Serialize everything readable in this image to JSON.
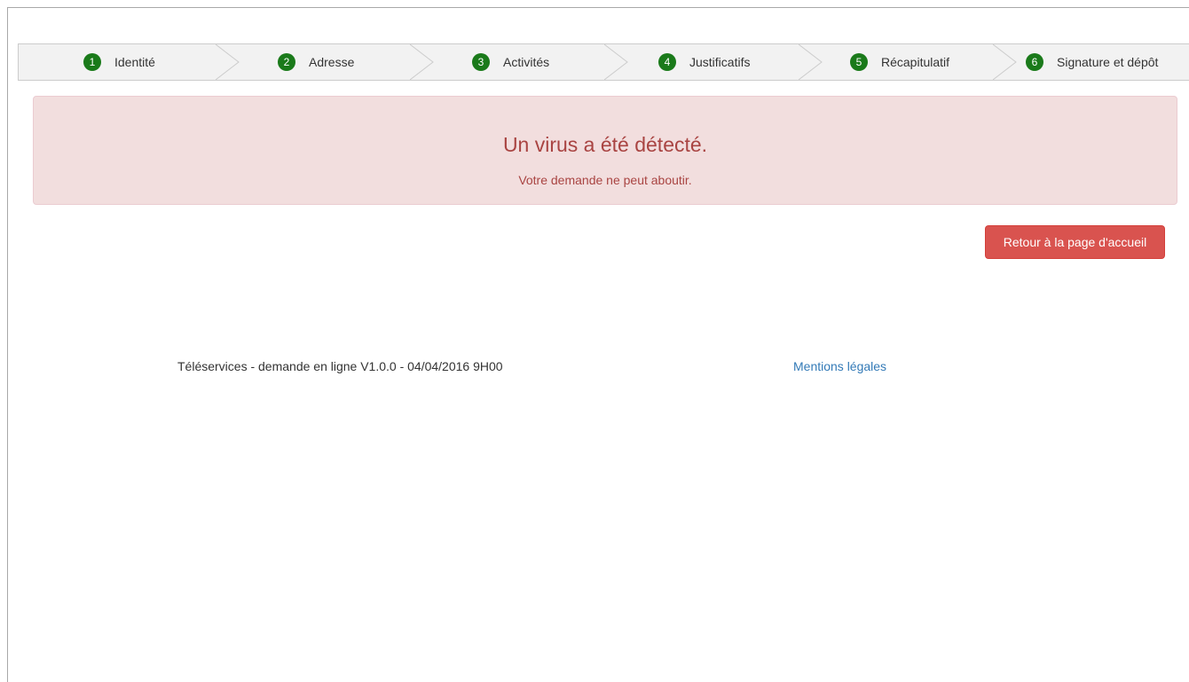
{
  "steps": [
    {
      "number": "1",
      "label": "Identité"
    },
    {
      "number": "2",
      "label": "Adresse"
    },
    {
      "number": "3",
      "label": "Activités"
    },
    {
      "number": "4",
      "label": "Justificatifs"
    },
    {
      "number": "5",
      "label": "Récapitulatif"
    },
    {
      "number": "6",
      "label": "Signature et dépôt"
    }
  ],
  "alert": {
    "title": "Un virus a été détecté.",
    "message": "Votre demande ne peut aboutir."
  },
  "actions": {
    "home_label": "Retour à la page d'accueil"
  },
  "footer": {
    "version_text": "Téléservices - demande en ligne V1.0.0 - 04/04/2016 9H00",
    "legal_link": "Mentions légales"
  },
  "colors": {
    "step_badge": "#1a7a1a",
    "alert_background": "#f2dede",
    "alert_text": "#a94442",
    "danger_button": "#d9534f",
    "link": "#337ab7"
  }
}
